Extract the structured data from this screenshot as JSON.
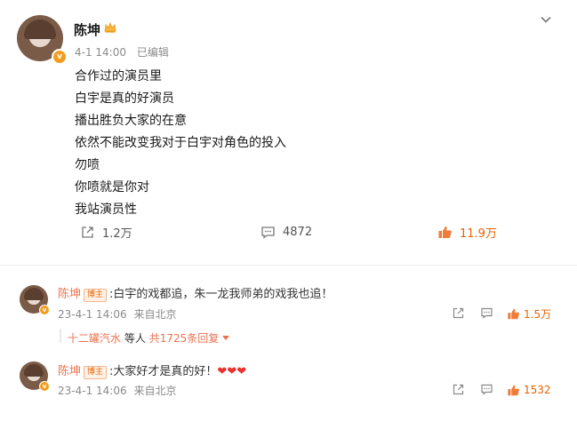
{
  "post": {
    "author": "陈坤",
    "timestamp": "4-1 14:00",
    "edited": "已编辑",
    "lines": [
      "合作过的演员里",
      "白宇是真的好演员",
      "播出胜负大家的在意",
      "依然不能改变我对于白宇对角色的投入",
      "勿喷",
      "你喷就是你对",
      "我站演员性"
    ],
    "actions": {
      "share_count": "1.2万",
      "comment_count": "4872",
      "like_count": "11.9万"
    }
  },
  "comments": [
    {
      "author": "陈坤",
      "badge": "博主",
      "text": ":白宇的戏都追，朱一龙我师弟的戏我也追！",
      "timestamp": "23-4-1 14:06",
      "source": "来自北京",
      "like_count": "1.5万",
      "replies": {
        "first_replier": "十二罐汽水",
        "others": "等人",
        "total": "共1725条回复"
      }
    },
    {
      "author": "陈坤",
      "badge": "博主",
      "text": ":大家好才是真的好！",
      "hearts": "❤❤❤",
      "timestamp": "23-4-1 14:06",
      "source": "来自北京",
      "like_count": "1532"
    }
  ],
  "icons": {
    "verified": "verified-badge-icon",
    "crown": "crown-icon",
    "more": "chevron-down-icon",
    "share": "share-icon",
    "comment": "comment-icon",
    "like": "thumbs-up-icon"
  },
  "colors": {
    "accent": "#e76300",
    "link": "#eb7350",
    "verified": "#f29d1f",
    "muted": "#8a8a8a"
  }
}
